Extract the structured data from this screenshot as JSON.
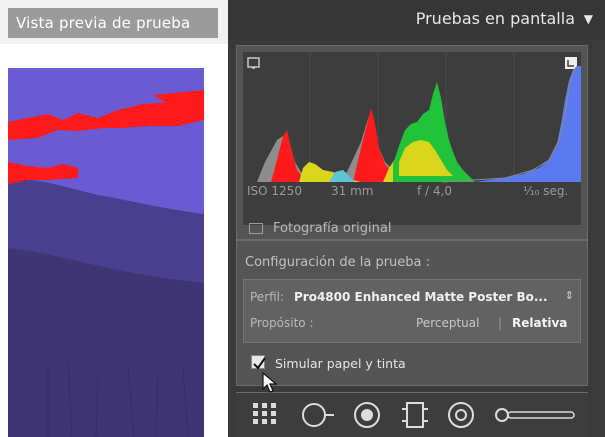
{
  "left": {
    "tab_label": "Vista previa de prueba"
  },
  "panel": {
    "title": "Pruebas en pantalla",
    "arrow": "▼",
    "histogram": {
      "iso": "ISO 1250",
      "focal": "31 mm",
      "aperture": "f / 4,0",
      "shutter": "¹⁄₁₀ seg.",
      "original_label": "Fotografía original"
    },
    "config": {
      "title": "Configuración de la prueba :",
      "perfil_label": "Perfil:",
      "perfil_value": "Pro4800 Enhanced Matte Poster Bo...",
      "perfil_stepper": "⇕",
      "proposito_label": "Propósito :",
      "perceptual": "Perceptual",
      "divider": "|",
      "relativa": "Relativa",
      "simulate_label": "Simular papel y tinta",
      "simulate_checked": true
    }
  },
  "icons": {
    "histogram_left": "shadow-clipping-icon",
    "histogram_right": "highlight-clipping-icon",
    "toolbar": [
      "grid-crop-icon",
      "spot-removal-icon",
      "redeye-icon",
      "graduated-filter-icon",
      "radial-filter-icon",
      "brush-slider-icon"
    ]
  },
  "colors": {
    "panel_bg": "#3a3a3a",
    "section_bg": "#545454",
    "accent_red": "#ff1b1b",
    "accent_green": "#23c23b",
    "accent_yellow": "#d9d51a",
    "accent_blue": "#5b7af0"
  }
}
